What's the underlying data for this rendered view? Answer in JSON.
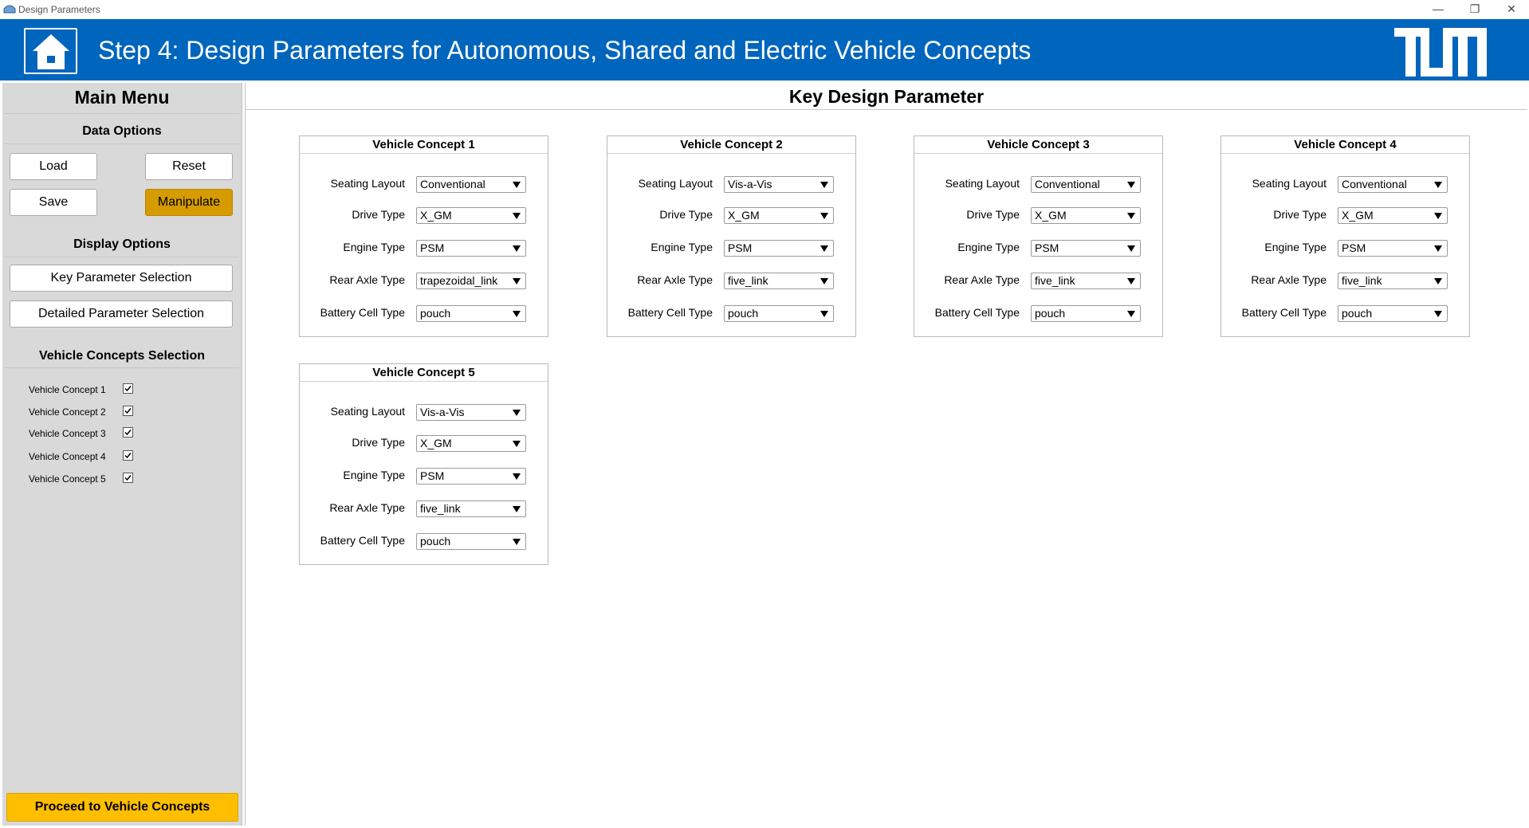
{
  "window": {
    "title": "Design Parameters"
  },
  "header": {
    "title": "Step 4: Design Parameters for Autonomous, Shared and Electric Vehicle Concepts",
    "accent_color": "#0065bd"
  },
  "sidebar": {
    "title": "Main Menu",
    "data_options": {
      "heading": "Data Options",
      "load": "Load",
      "reset": "Reset",
      "save": "Save",
      "manipulate": "Manipulate"
    },
    "display_options": {
      "heading": "Display Options",
      "key_parameter_selection": "Key Parameter Selection",
      "detailed_parameter_selection": "Detailed Parameter Selection"
    },
    "vehicle_concepts_selection": {
      "heading": "Vehicle Concepts Selection",
      "items": [
        {
          "label": "Vehicle Concept 1",
          "checked": true
        },
        {
          "label": "Vehicle Concept 2",
          "checked": true
        },
        {
          "label": "Vehicle Concept 3",
          "checked": true
        },
        {
          "label": "Vehicle Concept 4",
          "checked": true
        },
        {
          "label": "Vehicle Concept 5",
          "checked": true
        }
      ]
    },
    "proceed_button": "Proceed to Vehicle Concepts"
  },
  "main": {
    "title": "Key Design Parameter",
    "field_labels": {
      "seating_layout": "Seating Layout",
      "drive_type": "Drive Type",
      "engine_type": "Engine Type",
      "rear_axle_type": "Rear Axle Type",
      "battery_cell_type": "Battery Cell Type"
    },
    "concepts": [
      {
        "title": "Vehicle Concept 1",
        "seating_layout": "Conventional",
        "drive_type": "X_GM",
        "engine_type": "PSM",
        "rear_axle_type": "trapezoidal_link",
        "battery_cell_type": "pouch"
      },
      {
        "title": "Vehicle Concept 2",
        "seating_layout": "Vis-a-Vis",
        "drive_type": "X_GM",
        "engine_type": "PSM",
        "rear_axle_type": "five_link",
        "battery_cell_type": "pouch"
      },
      {
        "title": "Vehicle Concept 3",
        "seating_layout": "Conventional",
        "drive_type": "X_GM",
        "engine_type": "PSM",
        "rear_axle_type": "five_link",
        "battery_cell_type": "pouch"
      },
      {
        "title": "Vehicle Concept 4",
        "seating_layout": "Conventional",
        "drive_type": "X_GM",
        "engine_type": "PSM",
        "rear_axle_type": "five_link",
        "battery_cell_type": "pouch"
      },
      {
        "title": "Vehicle Concept 5",
        "seating_layout": "Vis-a-Vis",
        "drive_type": "X_GM",
        "engine_type": "PSM",
        "rear_axle_type": "five_link",
        "battery_cell_type": "pouch"
      }
    ]
  }
}
